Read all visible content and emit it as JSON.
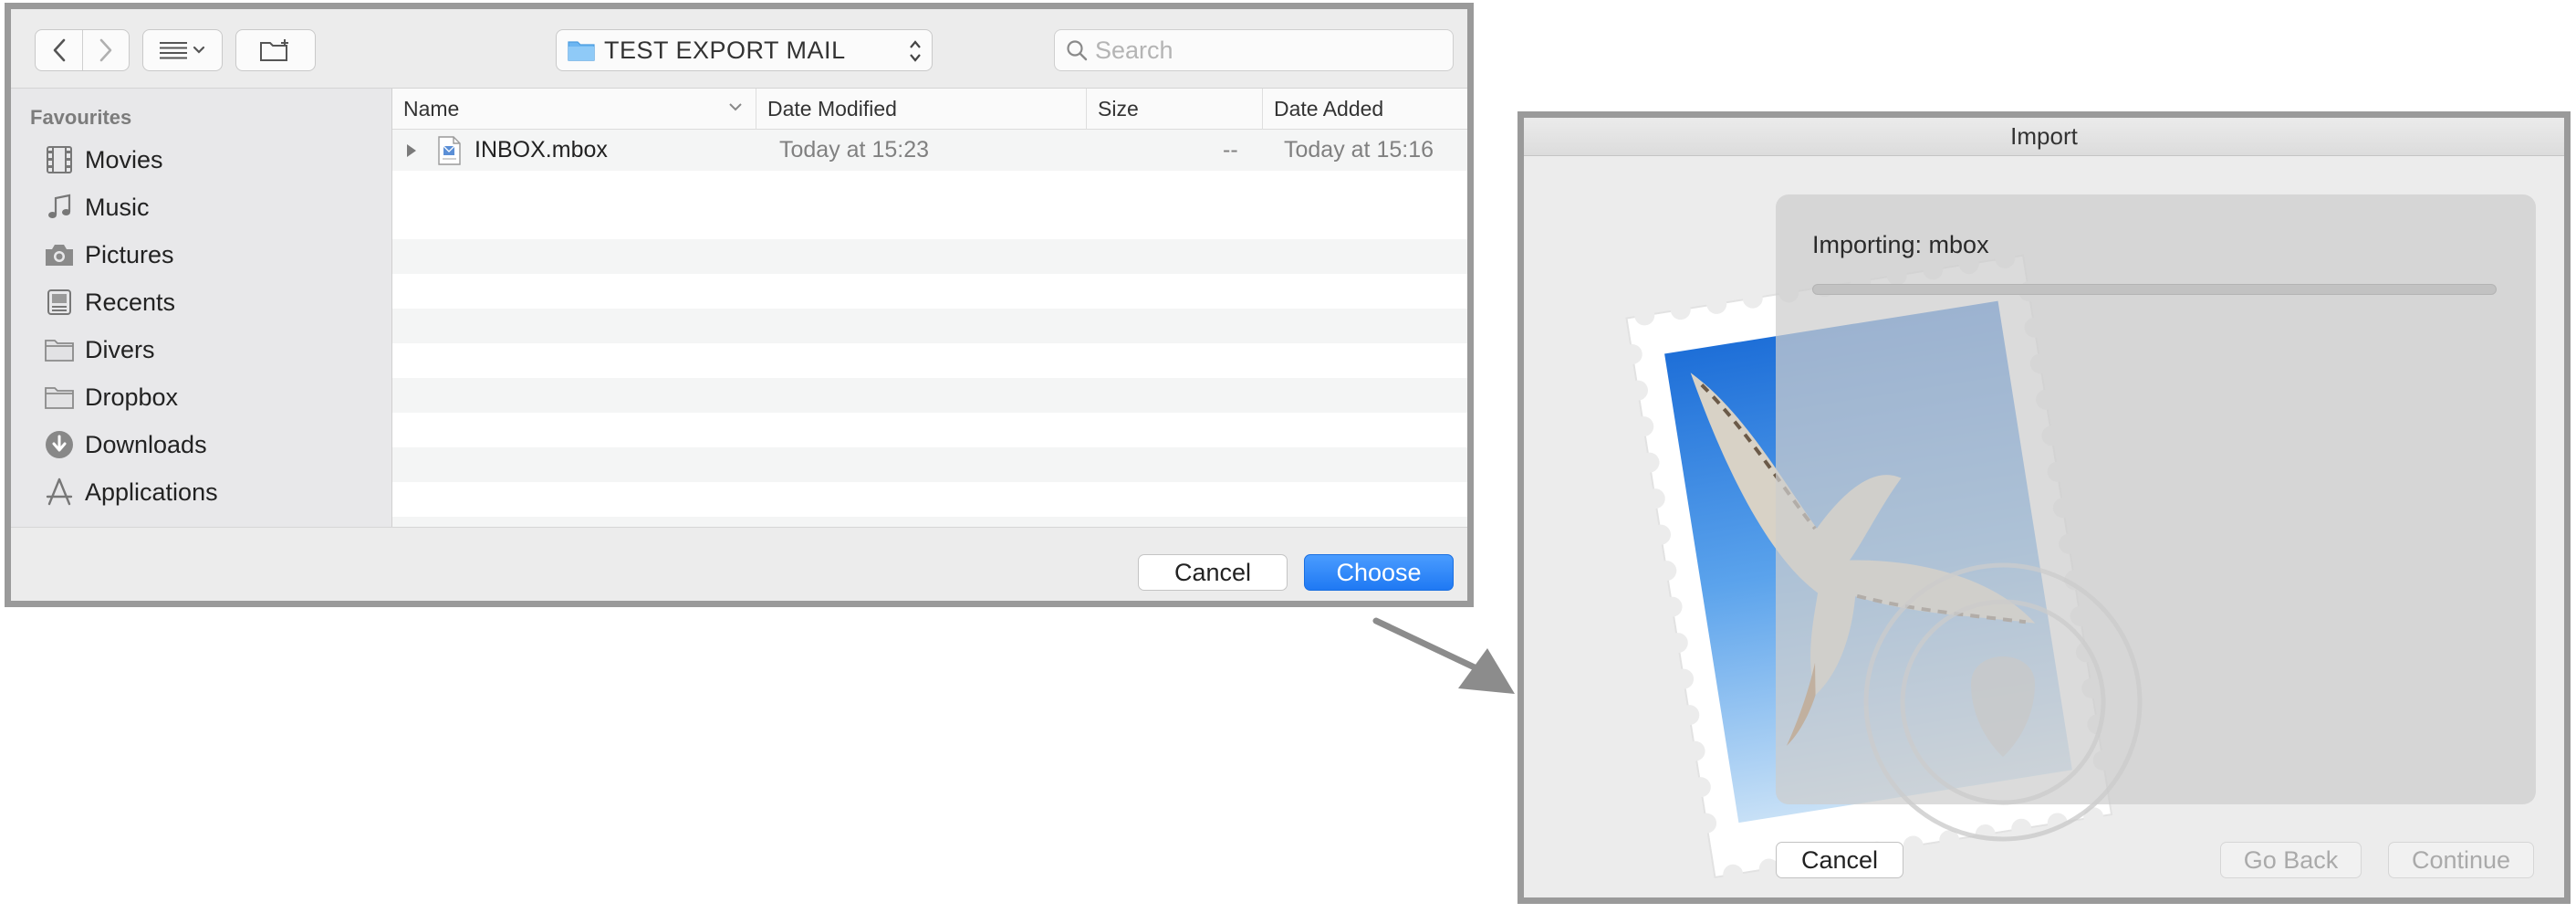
{
  "finder": {
    "toolbar": {
      "back_icon": "chevron-left-icon",
      "forward_icon": "chevron-right-icon",
      "view_icon": "list-view-icon",
      "new_folder_icon": "new-folder-icon",
      "location": "TEST EXPORT MAIL",
      "search_placeholder": "Search"
    },
    "sidebar": {
      "header": "Favourites",
      "items": [
        {
          "label": "Movies",
          "icon": "film-icon"
        },
        {
          "label": "Music",
          "icon": "music-note-icon"
        },
        {
          "label": "Pictures",
          "icon": "camera-icon"
        },
        {
          "label": "Recents",
          "icon": "recents-icon"
        },
        {
          "label": "Divers",
          "icon": "folder-icon"
        },
        {
          "label": "Dropbox",
          "icon": "folder-icon"
        },
        {
          "label": "Downloads",
          "icon": "download-icon"
        },
        {
          "label": "Applications",
          "icon": "applications-icon"
        }
      ]
    },
    "columns": {
      "name": "Name",
      "date_modified": "Date Modified",
      "size": "Size",
      "date_added": "Date Added"
    },
    "files": [
      {
        "name": "INBOX.mbox",
        "date_modified": "Today at 15:23",
        "size": "--",
        "date_added": "Today at 15:16"
      }
    ],
    "buttons": {
      "cancel": "Cancel",
      "choose": "Choose"
    },
    "accent_color": "#1f79f3"
  },
  "import_dialog": {
    "title": "Import",
    "progress_label": "Importing: mbox",
    "progress_fraction": 0,
    "buttons": {
      "cancel": "Cancel",
      "go_back": "Go Back",
      "continue": "Continue"
    }
  }
}
